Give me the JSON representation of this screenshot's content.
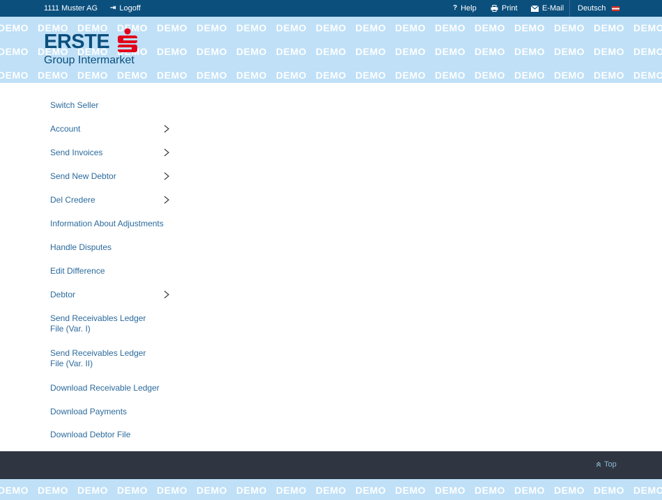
{
  "topbar": {
    "user": "1111 Muster AG",
    "logoff": "Logoff",
    "help": "Help",
    "print": "Print",
    "email": "E-Mail",
    "language": "Deutsch"
  },
  "watermark": "DEMO",
  "logo": {
    "brand": "ERSTE",
    "sub": "Group Intermarket"
  },
  "nav": {
    "items": [
      {
        "label": "Switch Seller",
        "has_submenu": false
      },
      {
        "label": "Account",
        "has_submenu": true
      },
      {
        "label": "Send Invoices",
        "has_submenu": true
      },
      {
        "label": "Send New Debtor",
        "has_submenu": true
      },
      {
        "label": "Del Credere",
        "has_submenu": true
      },
      {
        "label": "Information About Adjustments",
        "has_submenu": false
      },
      {
        "label": "Handle Disputes",
        "has_submenu": false
      },
      {
        "label": "Edit Difference",
        "has_submenu": false
      },
      {
        "label": "Debtor",
        "has_submenu": true
      },
      {
        "label": "Send Receivables Ledger File (Var. I)",
        "has_submenu": false
      },
      {
        "label": "Send Receivables Ledger File (Var. II)",
        "has_submenu": false
      },
      {
        "label": "Download Receivable Ledger",
        "has_submenu": false
      },
      {
        "label": "Download Payments",
        "has_submenu": false
      },
      {
        "label": "Download Debtor File",
        "has_submenu": false
      }
    ]
  },
  "footer": {
    "top_label": "Top"
  },
  "colors": {
    "topbar": "#0b4f7d",
    "band": "#bfe0f7",
    "link": "#2b6a9c",
    "footer": "#2f3641",
    "brand_red": "#e2001a"
  }
}
